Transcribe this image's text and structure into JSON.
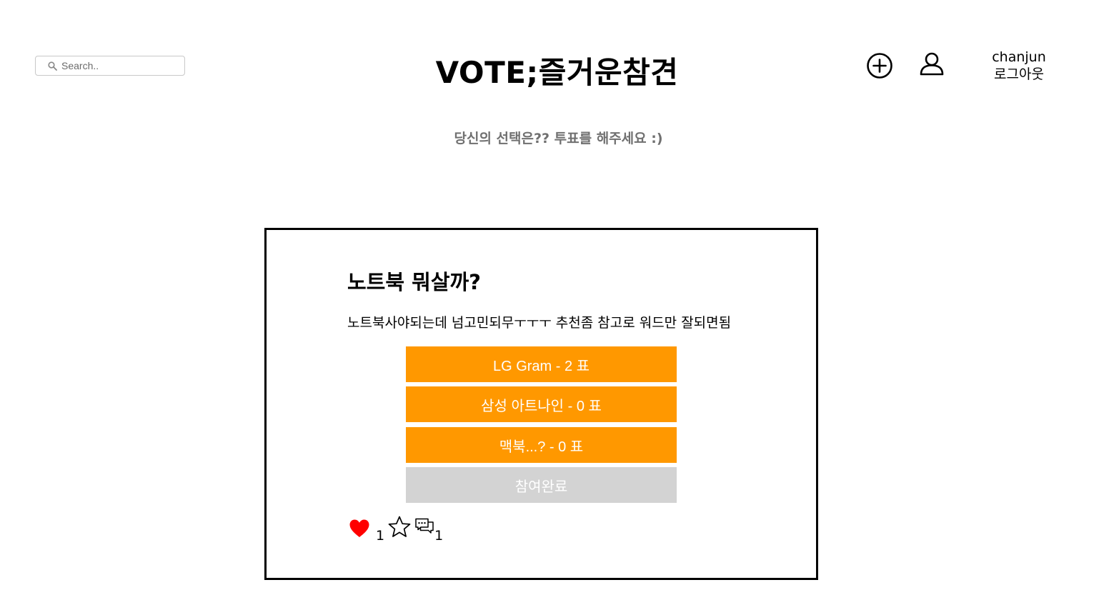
{
  "header": {
    "search_placeholder": "Search..",
    "site_title": "VOTE;즐거운참견",
    "username": "chanjun",
    "logout_label": "로그아웃"
  },
  "subtitle": "당신의 선택은?? 투표를 해주세요 :)",
  "poll": {
    "title": "노트북 뭐살까?",
    "description": "노트북사야되는데 넘고민되무ㅜㅜㅜ 추천좀 참고로 워드만 잘되면됨",
    "options": [
      {
        "label": "LG Gram - 2 표"
      },
      {
        "label": "삼성 아트나인 - 0 표"
      },
      {
        "label": "맥북...? - 0 표"
      }
    ],
    "done_label": "참여완료",
    "like_count": "1",
    "comment_count": "1"
  },
  "colors": {
    "option_bg": "#ff9800",
    "done_bg": "#d3d3d3",
    "heart": "#ff0000",
    "subtitle": "#707070"
  },
  "icons": [
    "search-icon",
    "add-circle-icon",
    "user-icon",
    "heart-icon",
    "star-icon",
    "comment-icon"
  ]
}
